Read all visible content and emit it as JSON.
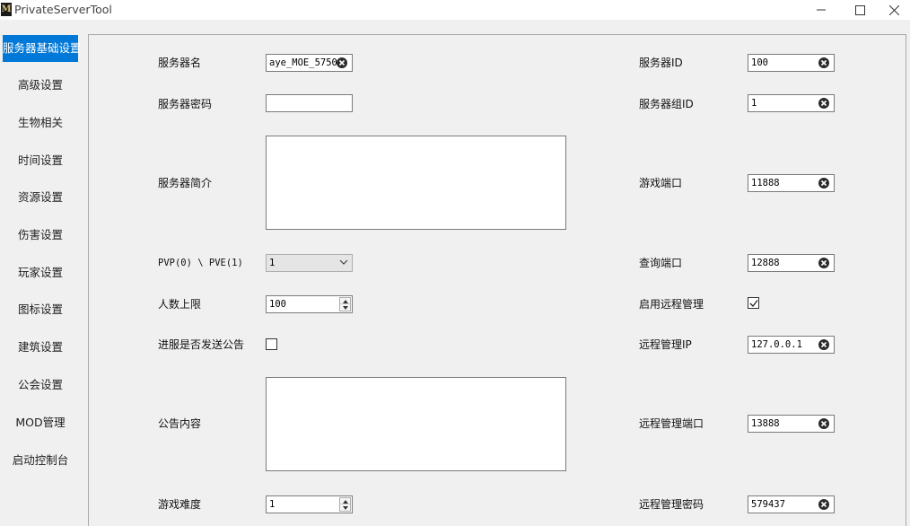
{
  "window": {
    "title": "PrivateServerTool",
    "icon_glyph": "M"
  },
  "sidebar": {
    "items": [
      {
        "label": "服务器基础设置",
        "active": true
      },
      {
        "label": "高级设置"
      },
      {
        "label": "生物相关"
      },
      {
        "label": "时间设置"
      },
      {
        "label": "资源设置"
      },
      {
        "label": "伤害设置"
      },
      {
        "label": "玩家设置"
      },
      {
        "label": "图标设置"
      },
      {
        "label": "建筑设置"
      },
      {
        "label": "公会设置"
      },
      {
        "label": "MOD管理"
      },
      {
        "label": "启动控制台"
      }
    ]
  },
  "form": {
    "server_name": {
      "label": "服务器名",
      "value": "aye_MOE_5750"
    },
    "server_password": {
      "label": "服务器密码",
      "value": ""
    },
    "server_description": {
      "label": "服务器简介",
      "value": ""
    },
    "pvp_pve": {
      "label": "PVP(0) \\ PVE(1)",
      "value": "1"
    },
    "max_players": {
      "label": "人数上限",
      "value": "100"
    },
    "join_announce": {
      "label": "进服是否发送公告",
      "checked": false
    },
    "announcement": {
      "label": "公告内容",
      "value": ""
    },
    "difficulty": {
      "label": "游戏难度",
      "value": "1"
    },
    "server_id": {
      "label": "服务器ID",
      "value": "100"
    },
    "server_group_id": {
      "label": "服务器组ID",
      "value": "1"
    },
    "game_port": {
      "label": "游戏端口",
      "value": "11888"
    },
    "query_port": {
      "label": "查询端口",
      "value": "12888"
    },
    "remote_enabled": {
      "label": "启用远程管理",
      "checked": true
    },
    "remote_ip": {
      "label": "远程管理IP",
      "value": "127.0.0.1"
    },
    "remote_port": {
      "label": "远程管理端口",
      "value": "13888"
    },
    "remote_password": {
      "label": "远程管理密码",
      "value": "579437"
    }
  },
  "colors": {
    "accent": "#0078d7",
    "background": "#f0f0f0"
  }
}
